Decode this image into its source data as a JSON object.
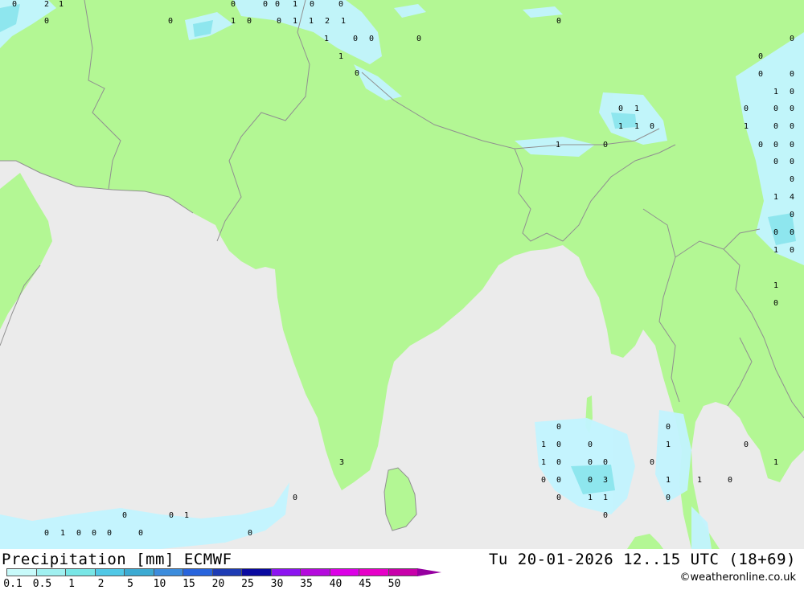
{
  "header": {
    "title": "Precipitation [mm] ECMWF",
    "datetime": "Tu 20-01-2026 12..15 UTC (18+69)",
    "credit": "©weatheronline.co.uk"
  },
  "colors": {
    "sea": "#ebebeb",
    "land": "#b3f794",
    "border": "#909090",
    "precip_light": "#c2f4ff",
    "precip_mid": "#8ee6ee"
  },
  "legend": {
    "ticks": [
      "0.1",
      "0.5",
      "1",
      "2",
      "5",
      "10",
      "15",
      "20",
      "25",
      "30",
      "35",
      "40",
      "45",
      "50"
    ],
    "colors": [
      "#c8fafa",
      "#a0f0f0",
      "#78e6e6",
      "#50c8e6",
      "#3caad2",
      "#3c8cdc",
      "#2864dc",
      "#1e3cb4",
      "#0a0aa0",
      "#8c14f0",
      "#b40adc",
      "#dc00e6",
      "#e600c8",
      "#c800aa"
    ]
  },
  "labels": [
    {
      "t": "0"
    },
    {
      "t": "2"
    },
    {
      "t": "1"
    },
    {
      "t": "0"
    },
    {
      "t": "0"
    },
    {
      "t": "0"
    },
    {
      "t": "0"
    },
    {
      "t": "0"
    },
    {
      "t": "1"
    },
    {
      "t": "0"
    },
    {
      "t": "0"
    },
    {
      "t": "1"
    },
    {
      "t": "0"
    },
    {
      "t": "0"
    },
    {
      "t": "1"
    },
    {
      "t": "1"
    },
    {
      "t": "2"
    },
    {
      "t": "1"
    },
    {
      "t": "1"
    },
    {
      "t": "0"
    },
    {
      "t": "0"
    },
    {
      "t": "0"
    },
    {
      "t": "1"
    },
    {
      "t": "0"
    },
    {
      "t": "0"
    },
    {
      "t": "0"
    },
    {
      "t": "0"
    },
    {
      "t": "0"
    },
    {
      "t": "0"
    },
    {
      "t": "1"
    },
    {
      "t": "0"
    },
    {
      "t": "0"
    },
    {
      "t": "1"
    },
    {
      "t": "0"
    },
    {
      "t": "0"
    },
    {
      "t": "0"
    },
    {
      "t": "1"
    },
    {
      "t": "1"
    },
    {
      "t": "0"
    },
    {
      "t": "1"
    },
    {
      "t": "0"
    },
    {
      "t": "0"
    },
    {
      "t": "1"
    },
    {
      "t": "0"
    },
    {
      "t": "0"
    },
    {
      "t": "0"
    },
    {
      "t": "0"
    },
    {
      "t": "0"
    },
    {
      "t": "0"
    },
    {
      "t": "0"
    },
    {
      "t": "1"
    },
    {
      "t": "4"
    },
    {
      "t": "0"
    },
    {
      "t": "0"
    },
    {
      "t": "0"
    },
    {
      "t": "1"
    },
    {
      "t": "0"
    },
    {
      "t": "1"
    },
    {
      "t": "0"
    },
    {
      "t": "0"
    },
    {
      "t": "0"
    },
    {
      "t": "1"
    },
    {
      "t": "0"
    },
    {
      "t": "0"
    },
    {
      "t": "1"
    },
    {
      "t": "0"
    },
    {
      "t": "1"
    },
    {
      "t": "0"
    },
    {
      "t": "0"
    },
    {
      "t": "0"
    },
    {
      "t": "0"
    },
    {
      "t": "1"
    },
    {
      "t": "3"
    },
    {
      "t": "0"
    },
    {
      "t": "0"
    },
    {
      "t": "0"
    },
    {
      "t": "3"
    },
    {
      "t": "1"
    },
    {
      "t": "1"
    },
    {
      "t": "0"
    },
    {
      "t": "0"
    },
    {
      "t": "1"
    },
    {
      "t": "1"
    },
    {
      "t": "0"
    },
    {
      "t": "0"
    },
    {
      "t": "0"
    },
    {
      "t": "0"
    },
    {
      "t": "1"
    },
    {
      "t": "0"
    },
    {
      "t": "0"
    },
    {
      "t": "1"
    },
    {
      "t": "0"
    },
    {
      "t": "0"
    },
    {
      "t": "0"
    },
    {
      "t": "0"
    },
    {
      "t": "0"
    }
  ]
}
